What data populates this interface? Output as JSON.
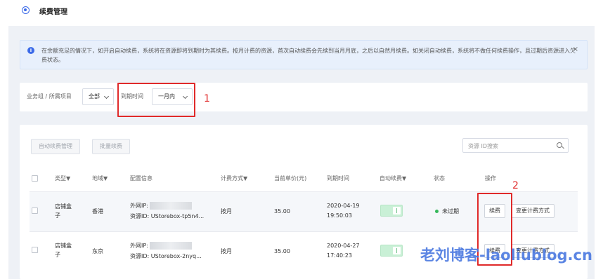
{
  "header": {
    "title": "续费管理",
    "icon": "renew-icon"
  },
  "notice": {
    "text": "在余额充足的情况下，如开启自动续费，系统将在资源即将到期时为其续费。按月计费的资源，首次自动续费会先续到当月月底，之后以自然月续费。如关闭自动续费，系统将不做任何续费操作，且过期后资源进入欠费状态。",
    "close": "×"
  },
  "filter": {
    "group_label": "业务组 / 所属项目",
    "group_value": "全部",
    "expire_label": "到期时间",
    "expire_value": "一月内",
    "mark1": "1"
  },
  "toolbar": {
    "auto_renew_manage": "自动续费管理",
    "batch_renew": "批量续费",
    "search_placeholder": "资源 ID搜索"
  },
  "table": {
    "headers": {
      "type": "类型▼",
      "region": "地域▼",
      "config": "配置信息",
      "billing": "计费方式▼",
      "price": "当前单价(元)",
      "expire": "到期时间",
      "auto": "自动续费▼",
      "status": "状态",
      "action": "操作"
    },
    "rows": [
      {
        "type": "店铺盒子",
        "region": "香港",
        "ip_label": "外网IP:",
        "resource": "资源ID: UStorebox-tp5n4...",
        "billing": "按月",
        "price": "35.00",
        "expire_date": "2020-04-19",
        "expire_time": "19:50:03",
        "status": "未过期",
        "renew": "续费",
        "change": "变更计费方式"
      },
      {
        "type": "店铺盒子",
        "region": "东京",
        "ip_label": "外网IP:",
        "resource": "资源ID: UStorebox-2nyq...",
        "billing": "按月",
        "price": "35.00",
        "expire_date": "2020-04-27",
        "expire_time": "17:40:23",
        "status": "",
        "renew": "续费",
        "change": "变更计费方式"
      }
    ],
    "mark2": "2"
  },
  "watermark": "老刘博客-laoliublog.cn",
  "colors": {
    "accent": "#3b6ae8",
    "annotation": "#e02a2a",
    "status_ok": "#35b85a"
  }
}
